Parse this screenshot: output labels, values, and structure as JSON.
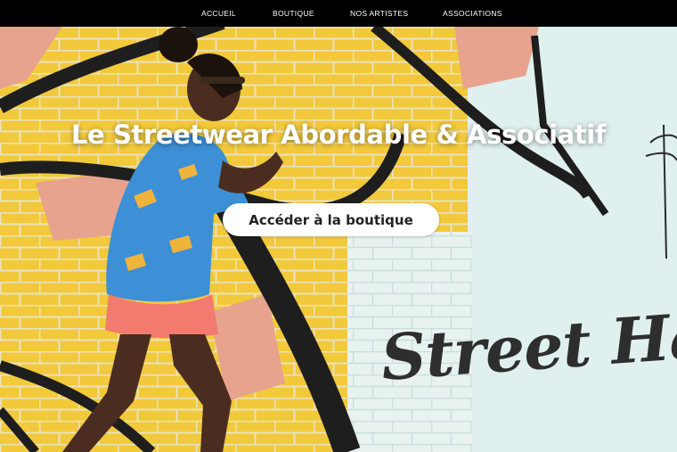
{
  "nav": {
    "items": [
      {
        "label": "ACCUEIL"
      },
      {
        "label": "BOUTIQUE"
      },
      {
        "label": "NOS ARTISTES"
      },
      {
        "label": "ASSOCIATIONS"
      }
    ]
  },
  "hero": {
    "title": "Le Streetwear Abordable & Associatif",
    "cta_label": "Accéder à la boutique",
    "wall_text": "Street Hal"
  },
  "colors": {
    "nav_bg": "#000000",
    "brick_yellow": "#f2c93a",
    "mural_black": "#1e1e1e",
    "mural_pink": "#e7a38e",
    "mural_light": "#dff0ef",
    "button_bg": "#ffffff"
  }
}
